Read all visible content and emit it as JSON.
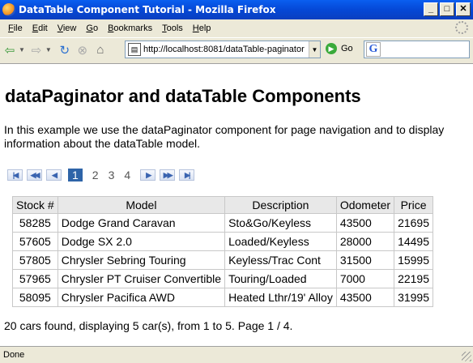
{
  "window": {
    "title": "DataTable Component Tutorial - Mozilla Firefox"
  },
  "menu": [
    {
      "label": "File",
      "key": "F"
    },
    {
      "label": "Edit",
      "key": "E"
    },
    {
      "label": "View",
      "key": "V"
    },
    {
      "label": "Go",
      "key": "G"
    },
    {
      "label": "Bookmarks",
      "key": "B"
    },
    {
      "label": "Tools",
      "key": "T"
    },
    {
      "label": "Help",
      "key": "H"
    }
  ],
  "toolbar": {
    "url": "http://localhost:8081/dataTable-paginator",
    "go_label": "Go"
  },
  "page": {
    "heading": "dataPaginator and dataTable Components",
    "intro": "In this example we use the dataPaginator component for page navigation and to display information about the dataTable model.",
    "pager": {
      "first": "K",
      "fast_back": "<<",
      "prev": "<",
      "pages": [
        "1",
        "2",
        "3",
        "4"
      ],
      "active_page": "1",
      "next": ">",
      "fast_forward": ">>",
      "last": ">|"
    },
    "table": {
      "headers": [
        "Stock #",
        "Model",
        "Description",
        "Odometer",
        "Price"
      ],
      "rows": [
        [
          "58285",
          "Dodge Grand Caravan",
          "Sto&Go/Keyless",
          "43500",
          "21695"
        ],
        [
          "57605",
          "Dodge SX 2.0",
          "Loaded/Keyless",
          "28000",
          "14495"
        ],
        [
          "57805",
          "Chrysler Sebring Touring",
          "Keyless/Trac Cont",
          "31500",
          "15995"
        ],
        [
          "57965",
          "Chrysler PT Cruiser Convertible",
          "Touring/Loaded",
          "7000",
          "22195"
        ],
        [
          "58095",
          "Chrysler Pacifica AWD",
          "Heated Lthr/19' Alloy",
          "43500",
          "31995"
        ]
      ]
    },
    "summary": "20 cars found, displaying 5 car(s), from 1 to 5. Page 1 / 4."
  },
  "status": {
    "text": "Done"
  }
}
